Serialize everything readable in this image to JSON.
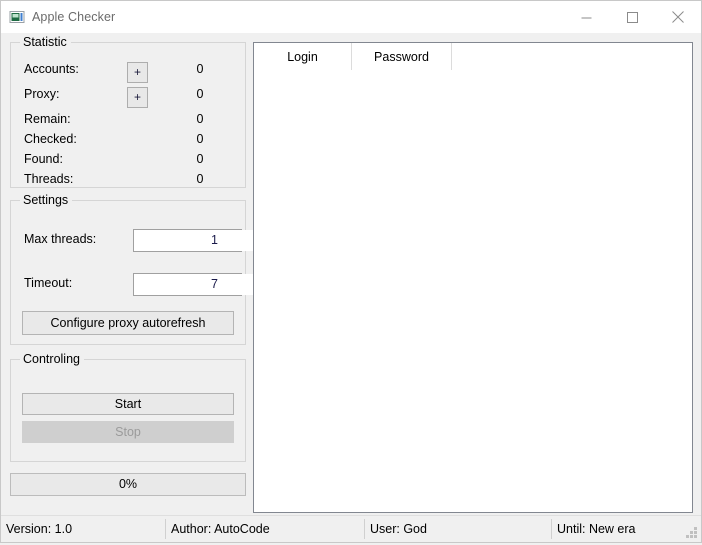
{
  "window": {
    "title": "Apple Checker",
    "icon": "application-window-icon",
    "controls": {
      "minimize": "minimize-icon",
      "maximize": "maximize-icon",
      "close": "close-icon"
    }
  },
  "statistic": {
    "legend": "Statistic",
    "rows": [
      {
        "label": "Accounts:",
        "button": "+",
        "value": "0"
      },
      {
        "label": "Proxy:",
        "button": "+",
        "value": "0"
      },
      {
        "label": "Remain:",
        "value": "0"
      },
      {
        "label": "Checked:",
        "value": "0"
      },
      {
        "label": "Found:",
        "value": "0"
      },
      {
        "label": "Threads:",
        "value": "0"
      }
    ]
  },
  "settings": {
    "legend": "Settings",
    "max_threads_label": "Max threads:",
    "max_threads_value": "1",
    "timeout_label": "Timeout:",
    "timeout_value": "7",
    "configure_button": "Configure proxy autorefresh"
  },
  "controling": {
    "legend": "Controling",
    "start_button": "Start",
    "stop_button": "Stop"
  },
  "progress": {
    "text": "0%",
    "percent": 0
  },
  "listview": {
    "columns": [
      "Login",
      "Password"
    ],
    "rows": []
  },
  "statusbar": {
    "version": "Version: 1.0",
    "author": "Author: AutoCode",
    "user": "User: God",
    "until": "Until: New era"
  },
  "colors": {
    "window_bg": "#f0f0f0",
    "titlebar_bg": "#ffffff",
    "title_text": "#6b6b6b",
    "listview_bg": "#ffffff",
    "listview_border": "#828790",
    "button_face": "#e9e9e9",
    "button_border": "#b4b4b4",
    "disabled_face": "#cfcfcf",
    "disabled_text": "#9b9b9b",
    "group_border": "#d5d5d5",
    "progress_fill": "#06b025"
  }
}
